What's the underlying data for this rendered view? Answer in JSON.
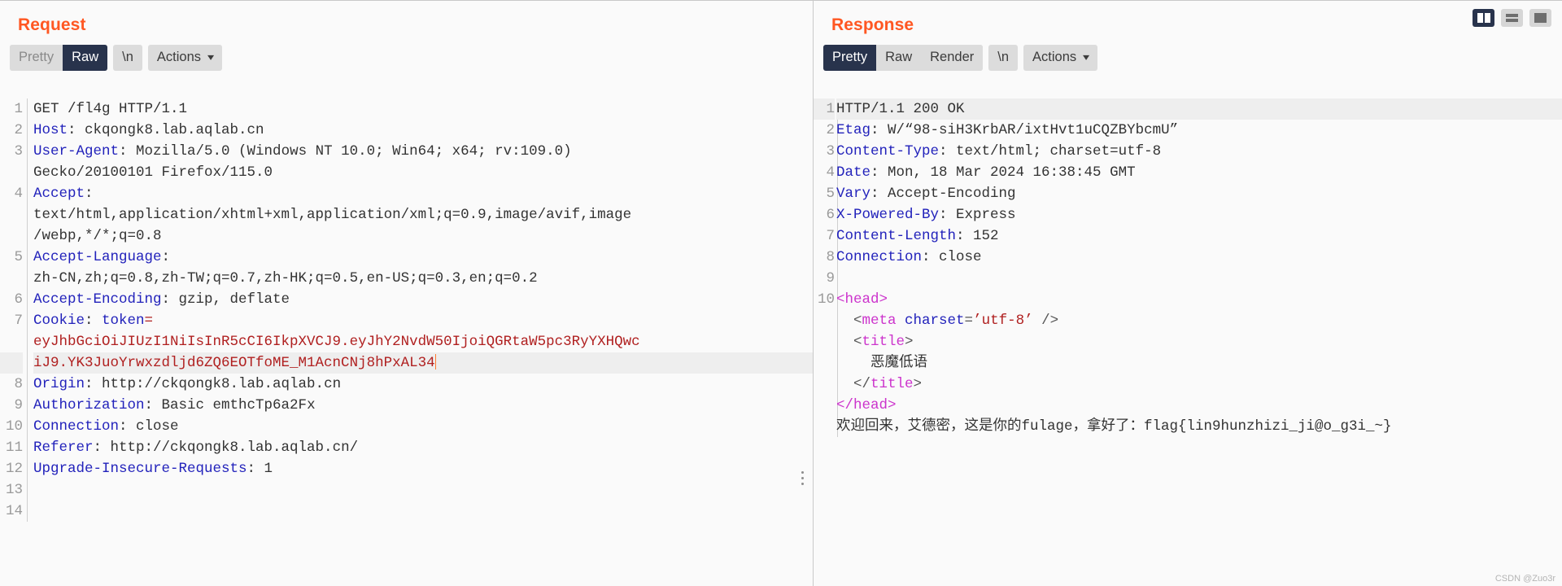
{
  "request": {
    "title": "Request",
    "tabs": [
      {
        "label": "Pretty",
        "active": false
      },
      {
        "label": "Raw",
        "active": true
      }
    ],
    "newline_label": "\\n",
    "actions_label": "Actions",
    "lines": [
      {
        "num": "1",
        "segments": [
          {
            "t": "GET /fl4g HTTP/1.1",
            "c": "plain"
          }
        ]
      },
      {
        "num": "2",
        "segments": [
          {
            "t": "Host",
            "c": "k"
          },
          {
            "t": ": ckqongk8.lab.aqlab.cn",
            "c": "v"
          }
        ]
      },
      {
        "num": "3",
        "segments": [
          {
            "t": "User-Agent",
            "c": "k"
          },
          {
            "t": ": Mozilla/5.0 (Windows NT 10.0; Win64; x64; rv:109.0)",
            "c": "v"
          }
        ]
      },
      {
        "num": "",
        "segments": [
          {
            "t": "Gecko/20100101 Firefox/115.0",
            "c": "v"
          }
        ]
      },
      {
        "num": "4",
        "segments": [
          {
            "t": "Accept",
            "c": "k"
          },
          {
            "t": ":",
            "c": "v"
          }
        ]
      },
      {
        "num": "",
        "segments": [
          {
            "t": "text/html,application/xhtml+xml,application/xml;q=0.9,image/avif,image",
            "c": "v"
          }
        ]
      },
      {
        "num": "",
        "segments": [
          {
            "t": "/webp,*/*;q=0.8",
            "c": "v"
          }
        ]
      },
      {
        "num": "5",
        "segments": [
          {
            "t": "Accept-Language",
            "c": "k"
          },
          {
            "t": ":",
            "c": "v"
          }
        ]
      },
      {
        "num": "",
        "segments": [
          {
            "t": "zh-CN,zh;q=0.8,zh-TW;q=0.7,zh-HK;q=0.5,en-US;q=0.3,en;q=0.2",
            "c": "v"
          }
        ]
      },
      {
        "num": "6",
        "segments": [
          {
            "t": "Accept-Encoding",
            "c": "k"
          },
          {
            "t": ": gzip, deflate",
            "c": "v"
          }
        ]
      },
      {
        "num": "7",
        "segments": [
          {
            "t": "Cookie",
            "c": "k"
          },
          {
            "t": ": ",
            "c": "v"
          },
          {
            "t": "token",
            "c": "k"
          },
          {
            "t": "=",
            "c": "tok"
          }
        ]
      },
      {
        "num": "",
        "segments": [
          {
            "t": "eyJhbGciOiJIUzI1NiIsInR5cCI6IkpXVCJ9.eyJhY2NvdW50IjoiQGRtaW5pc3RyYXHQwc",
            "c": "tok"
          }
        ]
      },
      {
        "num": "",
        "highlight": true,
        "segments": [
          {
            "t": "iJ9.YK3JuoYrwxzdljd6ZQ6EOTfoME_M1AcnCNj8hPxAL34",
            "c": "tok"
          },
          {
            "t": "|CARET|",
            "c": "caret"
          }
        ]
      },
      {
        "num": "8",
        "segments": [
          {
            "t": "Origin",
            "c": "k"
          },
          {
            "t": ": http://ckqongk8.lab.aqlab.cn",
            "c": "v"
          }
        ]
      },
      {
        "num": "9",
        "segments": [
          {
            "t": "Authorization",
            "c": "k"
          },
          {
            "t": ": Basic emthcTp6a2Fx",
            "c": "v"
          }
        ]
      },
      {
        "num": "10",
        "segments": [
          {
            "t": "Connection",
            "c": "k"
          },
          {
            "t": ": close",
            "c": "v"
          }
        ]
      },
      {
        "num": "11",
        "segments": [
          {
            "t": "Referer",
            "c": "k"
          },
          {
            "t": ": http://ckqongk8.lab.aqlab.cn/",
            "c": "v"
          }
        ]
      },
      {
        "num": "12",
        "segments": [
          {
            "t": "Upgrade-Insecure-Requests",
            "c": "k"
          },
          {
            "t": ": 1",
            "c": "v"
          }
        ]
      },
      {
        "num": "13",
        "segments": []
      },
      {
        "num": "14",
        "segments": []
      }
    ]
  },
  "response": {
    "title": "Response",
    "tabs": [
      {
        "label": "Pretty",
        "active": true
      },
      {
        "label": "Raw",
        "active": false
      },
      {
        "label": "Render",
        "active": false
      }
    ],
    "newline_label": "\\n",
    "actions_label": "Actions",
    "lines": [
      {
        "num": "1",
        "highlight": true,
        "segments": [
          {
            "t": "HTTP/1.1 200 OK",
            "c": "plain"
          }
        ]
      },
      {
        "num": "2",
        "segments": [
          {
            "t": "Etag",
            "c": "k"
          },
          {
            "t": ": W/“98-siH3KrbAR/ixtHvt1uCQZBYbcmU”",
            "c": "v"
          }
        ]
      },
      {
        "num": "3",
        "segments": [
          {
            "t": "Content-Type",
            "c": "k"
          },
          {
            "t": ": text/html; charset=utf-8",
            "c": "v"
          }
        ]
      },
      {
        "num": "4",
        "segments": [
          {
            "t": "Date",
            "c": "k"
          },
          {
            "t": ": Mon, 18 Mar 2024 16:38:45 GMT",
            "c": "v"
          }
        ]
      },
      {
        "num": "5",
        "segments": [
          {
            "t": "Vary",
            "c": "k"
          },
          {
            "t": ": Accept-Encoding",
            "c": "v"
          }
        ]
      },
      {
        "num": "6",
        "segments": [
          {
            "t": "X-Powered-By",
            "c": "k"
          },
          {
            "t": ": Express",
            "c": "v"
          }
        ]
      },
      {
        "num": "7",
        "segments": [
          {
            "t": "Content-Length",
            "c": "k"
          },
          {
            "t": ": 152",
            "c": "v"
          }
        ]
      },
      {
        "num": "8",
        "segments": [
          {
            "t": "Connection",
            "c": "k"
          },
          {
            "t": ": close",
            "c": "v"
          }
        ]
      },
      {
        "num": "9",
        "segments": []
      },
      {
        "num": "10",
        "segments": [
          {
            "t": "<head>",
            "c": "tag"
          }
        ]
      },
      {
        "num": "",
        "segments": [
          {
            "t": "  <",
            "c": "punct"
          },
          {
            "t": "meta ",
            "c": "tag"
          },
          {
            "t": "charset",
            "c": "attr"
          },
          {
            "t": "=",
            "c": "punct"
          },
          {
            "t": "’utf-8’",
            "c": "str"
          },
          {
            "t": " />",
            "c": "punct"
          }
        ]
      },
      {
        "num": "",
        "segments": [
          {
            "t": "  <",
            "c": "punct"
          },
          {
            "t": "title",
            "c": "tag"
          },
          {
            "t": ">",
            "c": "punct"
          }
        ]
      },
      {
        "num": "",
        "segments": [
          {
            "t": "    恶魔低语",
            "c": "plain"
          }
        ]
      },
      {
        "num": "",
        "segments": [
          {
            "t": "  </",
            "c": "punct"
          },
          {
            "t": "title",
            "c": "tag"
          },
          {
            "t": ">",
            "c": "punct"
          }
        ]
      },
      {
        "num": "",
        "segments": [
          {
            "t": "</head>",
            "c": "tag"
          }
        ]
      },
      {
        "num": "",
        "segments": [
          {
            "t": "欢迎回来，艾德密，这是你的fulage，拿好了：flag{lin9hunzhizi_ji@o_g3i_~}",
            "c": "plain"
          }
        ]
      }
    ]
  },
  "layout_buttons": [
    {
      "name": "split-vertical-layout",
      "style": "split",
      "active": true
    },
    {
      "name": "split-horizontal-layout",
      "style": "rows",
      "active": false
    },
    {
      "name": "single-pane-layout",
      "style": "full",
      "active": false
    }
  ],
  "watermark": "CSDN @Zuo3r"
}
